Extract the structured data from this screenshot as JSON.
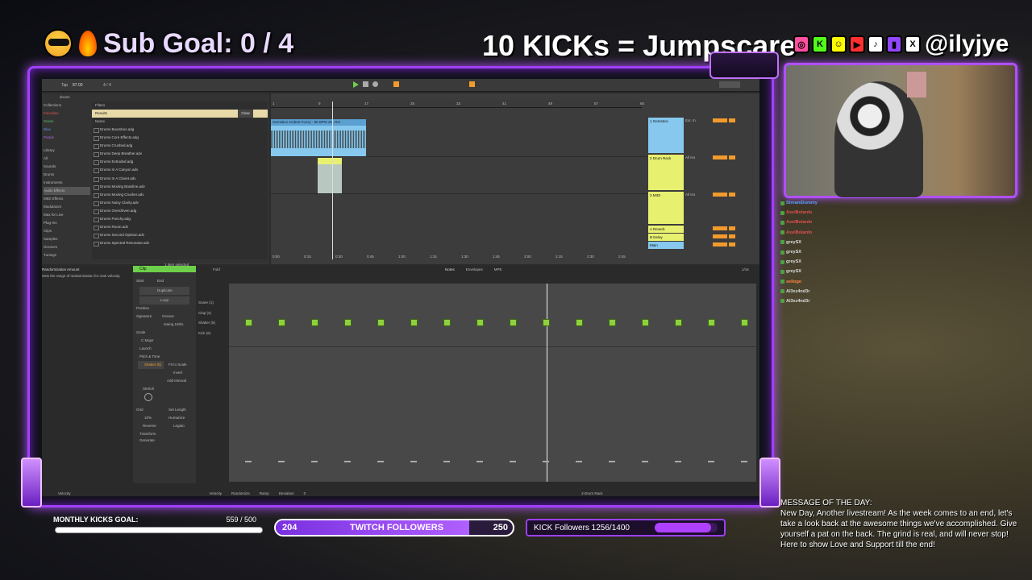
{
  "overlay": {
    "sub_goal": "Sub Goal: 0 / 4",
    "kicks_line": "10 KICKs = Jumpscare",
    "handle": "@ilyjye",
    "social_icons": [
      "instagram-icon",
      "kick-icon",
      "snapchat-icon",
      "youtube-icon",
      "tiktok-icon",
      "twitch-icon",
      "x-icon"
    ]
  },
  "daw": {
    "tempo": "87.00",
    "signature": "4 / 4",
    "browser": {
      "search": "drums",
      "collections_header": "Collections",
      "collections": [
        "Favorites",
        "Green",
        "Blue",
        "Purple"
      ],
      "library_header": "Library",
      "library": [
        "All",
        "Sounds",
        "Drums",
        "Instruments",
        "Audio Effects",
        "MIDI Effects",
        "Modulators",
        "Max for Live",
        "Plug-Ins",
        "Clips",
        "Samples",
        "Grooves",
        "Tunings"
      ],
      "filters_label": "Filters",
      "results_label": "Results",
      "clear_label": "Clear",
      "name_header": "Name",
      "files": [
        "Drums Boombox.adg",
        "Drums Core Effects.adg",
        "Drums Crushed.adg",
        "Drums Deep Breather.adv",
        "Drums Extruded.adg",
        "Drums In A Canyon.adv",
        "Drums In A Closet.adv",
        "Drums Moving Bassline.adv",
        "Drums Moving Crusher.adv",
        "Drums Noisy Clarity.adv",
        "Drums Overdriven.adg",
        "Drums Punchy.adg",
        "Drums Room.adv",
        "Drums Second Opinion.adv",
        "Drums Spectral Resonator.adv"
      ],
      "status": "1 item selected"
    },
    "tracks": [
      {
        "name": "1 Gemstice",
        "route": "Ext. In",
        "color": "#86c8ee"
      },
      {
        "name": "2 Drum Rack",
        "route": "All Ins",
        "color": "#e8f070"
      },
      {
        "name": "3 MIDI",
        "route": "All Ins",
        "color": "#e8f070"
      },
      {
        "name": "A Reverb",
        "color": "#e8f070"
      },
      {
        "name": "B Delay",
        "color": "#e8f070"
      },
      {
        "name": "Main",
        "color": "#86c8ee"
      }
    ],
    "ruler_marks": [
      "1",
      "9",
      "17",
      "25",
      "33",
      "41",
      "49",
      "57",
      "65"
    ],
    "time_marks": [
      "0:00",
      "0:15",
      "0:30",
      "0:45",
      "1:00",
      "1:15",
      "1:30",
      "1:45",
      "2:00",
      "2:15",
      "2:30",
      "2:45"
    ],
    "clip_title": "Gemstice Ambert Fuzzy - 85 BPM 2M Atm",
    "randomization": {
      "title": "Randomization Amount",
      "help": "Sets the range of randomization for note velocity."
    },
    "clip": {
      "label": "Clip",
      "fold": "Fold",
      "start": "Start",
      "end": "End",
      "duplicate": "Duplicate",
      "loop": "Loop",
      "position": "Position",
      "length": "Length",
      "signature": "Signature",
      "groove": "Groove",
      "swing": "Swing 16ths",
      "scale": "Scale",
      "key": "C",
      "mode": "Major",
      "launch": "Launch",
      "pitch_time": "Pitch & Time",
      "instrument": "Shaker (5)",
      "fit_scale": "Fit to Scale",
      "invert": "Invert",
      "add_interval": "Add Interval",
      "stretch": "Stretch",
      "grid": "Grid",
      "set_length": "Set Length",
      "humanize": "Humanize",
      "reverse": "Reverse",
      "legato": "Legato",
      "transform": "Transform",
      "generate": "Generate",
      "pct": "10%"
    },
    "note_rows": [
      "Snare (1)",
      "Clap (2)",
      "Shaker (5)",
      "Kick (6)"
    ],
    "tabs": [
      "Notes",
      "Envelopes",
      "MPE"
    ],
    "quantize": "1/16",
    "vel_label": "Velocity",
    "vel_randomize": "Randomize",
    "ramp": "Ramp",
    "deviation": "Deviation",
    "deviation_val": "0",
    "footer_track": "2-Drum Rack"
  },
  "chat": [
    {
      "name": "StreamDummy",
      "color": "#5aa0ff"
    },
    {
      "name": "AxelBolardo",
      "color": "#e05050"
    },
    {
      "name": "AxelBolardo",
      "color": "#e05050"
    },
    {
      "name": "AxelBolardo",
      "color": "#e05050"
    },
    {
      "name": "greySX",
      "color": "#dddddd"
    },
    {
      "name": "greySX",
      "color": "#dddddd"
    },
    {
      "name": "greySX",
      "color": "#dddddd"
    },
    {
      "name": "greySX",
      "color": "#dddddd"
    },
    {
      "name": "selloge",
      "color": "#ff8844"
    },
    {
      "name": "Al3xz4nd3r",
      "color": "#dddddd"
    },
    {
      "name": "Al3xz4nd3r",
      "color": "#dddddd"
    }
  ],
  "monthly_kicks": {
    "label": "MONTHLY KICKS GOAL:",
    "value": "559 / 500",
    "progress": 1.0
  },
  "twitch": {
    "current": "204",
    "label": "TWITCH FOLLOWERS",
    "target": "250",
    "progress": 0.816
  },
  "kick_followers": {
    "label": "KICK Followers 1256/1400",
    "progress": 0.897
  },
  "motd": {
    "title": "MESSAGE OF THE DAY:",
    "body": "New Day, Another livestream! As the week comes to an end, let's take a look back at the awesome things we've accomplished. Give yourself a pat on the back. The grind is real, and will never stop! Here to show Love and Support till the end!"
  }
}
